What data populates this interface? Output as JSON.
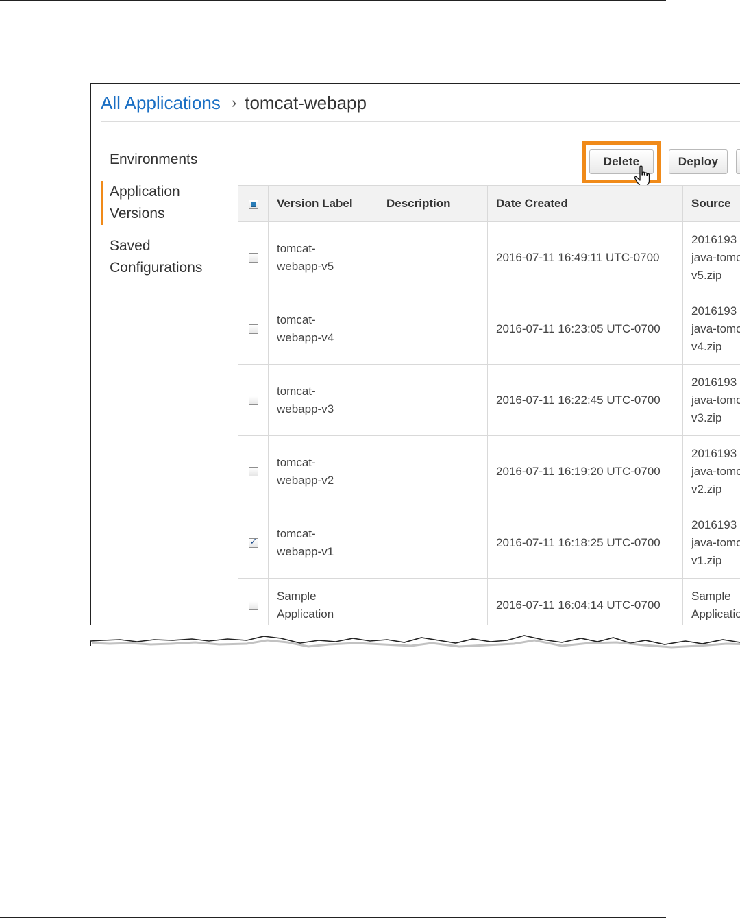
{
  "breadcrumb": {
    "root_label": "All Applications",
    "separator": "›",
    "current_label": "tomcat-webapp"
  },
  "sidebar": {
    "items": [
      {
        "label": "Environments",
        "active": false
      },
      {
        "label": "Application Versions",
        "active": true
      },
      {
        "label": "Saved Configurations",
        "active": false
      }
    ]
  },
  "toolbar": {
    "delete_label": "Delete",
    "deploy_label": "Deploy",
    "highlight_color": "#f08a19"
  },
  "table": {
    "select_all_state": "partial",
    "columns": [
      "Version Label",
      "Description",
      "Date Created",
      "Source"
    ],
    "rows": [
      {
        "label_line1": "tomcat-",
        "label_line2": "webapp-v5",
        "description": "",
        "date": "2016-07-11 16:49:11 UTC-0700",
        "source": [
          "2016193",
          "java-tomc",
          "v5.zip"
        ],
        "checked": false
      },
      {
        "label_line1": "tomcat-",
        "label_line2": "webapp-v4",
        "description": "",
        "date": "2016-07-11 16:23:05 UTC-0700",
        "source": [
          "2016193",
          "java-tomc",
          "v4.zip"
        ],
        "checked": false
      },
      {
        "label_line1": "tomcat-",
        "label_line2": "webapp-v3",
        "description": "",
        "date": "2016-07-11 16:22:45 UTC-0700",
        "source": [
          "2016193",
          "java-tomc",
          "v3.zip"
        ],
        "checked": false
      },
      {
        "label_line1": "tomcat-",
        "label_line2": "webapp-v2",
        "description": "",
        "date": "2016-07-11 16:19:20 UTC-0700",
        "source": [
          "2016193",
          "java-tomc",
          "v2.zip"
        ],
        "checked": false
      },
      {
        "label_line1": "tomcat-",
        "label_line2": "webapp-v1",
        "description": "",
        "date": "2016-07-11 16:18:25 UTC-0700",
        "source": [
          "2016193",
          "java-tomc",
          "v1.zip"
        ],
        "checked": true
      },
      {
        "label_line1": "Sample",
        "label_line2": "Application",
        "description": "",
        "date": "2016-07-11 16:04:14 UTC-0700",
        "source": [
          "Sample",
          "Applicatio"
        ],
        "checked": false
      }
    ]
  },
  "icons": {
    "cursor": "hand-pointer-icon"
  }
}
